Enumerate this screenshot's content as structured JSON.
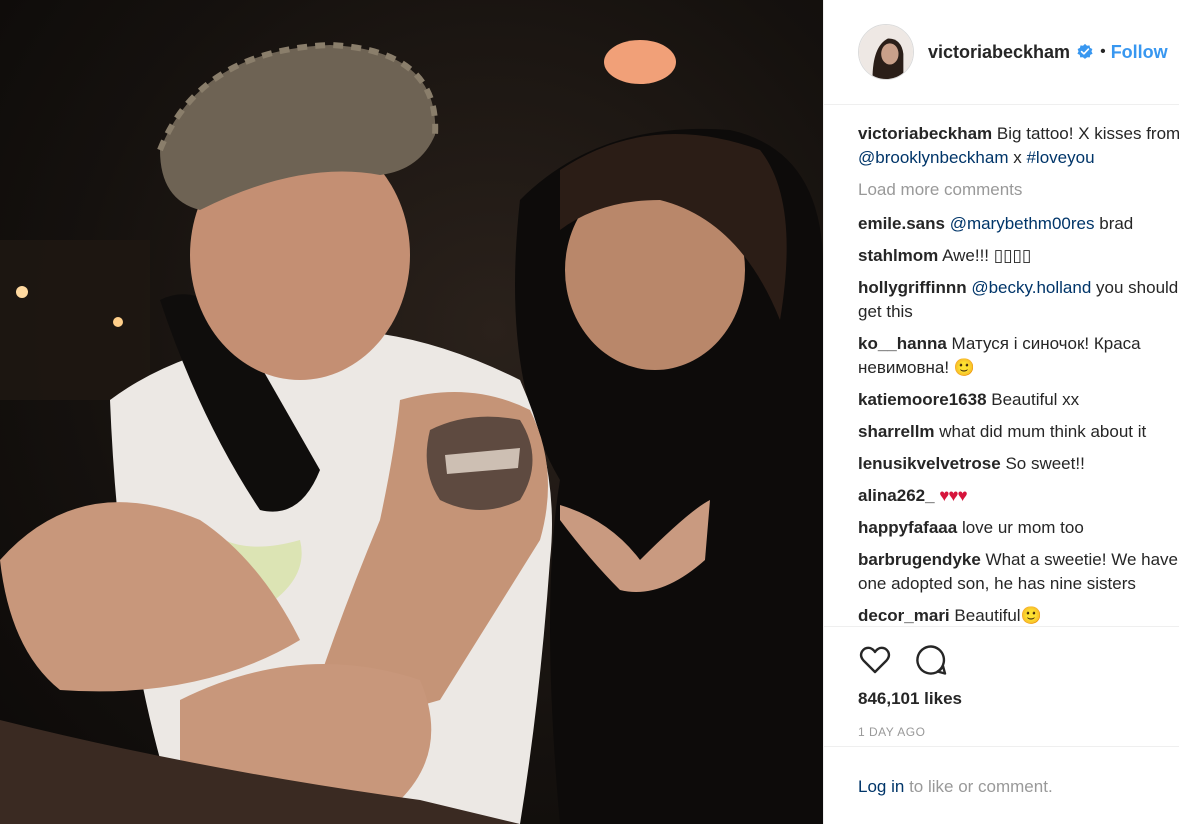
{
  "post": {
    "username": "victoriabeckham",
    "separator": "•",
    "follow_label": "Follow",
    "caption": {
      "user": "victoriabeckham",
      "text": "Big tattoo! X kisses from NYC!!",
      "mention": "@brooklynbeckham",
      "mid": "x",
      "hashtag": "#loveyou"
    },
    "load_more": "Load more comments",
    "comments": [
      {
        "user": "emile.sans",
        "link": "@marybethm00res",
        "text": "brad"
      },
      {
        "user": "stahlmom",
        "link": "",
        "text": "Awe!!! ▯▯▯▯"
      },
      {
        "user": "hollygriffinnn",
        "link": "@becky.holland",
        "text": "you should get this"
      },
      {
        "user": "ko__hanna",
        "link": "",
        "text": "Матуся і синочок! Краса невимовна! 🙂"
      },
      {
        "user": "katiemoore1638",
        "link": "",
        "text": "Beautiful xx"
      },
      {
        "user": "sharrellm",
        "link": "",
        "text": "what did mum think about it"
      },
      {
        "user": "lenusikvelvetrose",
        "link": "",
        "text": "So sweet!!"
      },
      {
        "user": "alina262_",
        "link": "",
        "text": "♥♥♥"
      },
      {
        "user": "happyfafaaa",
        "link": "",
        "text": "love ur mom too"
      },
      {
        "user": "barbrugendyke",
        "link": "",
        "text": "What a sweetie! We have one adopted son, he has nine sisters"
      },
      {
        "user": "decor_mari",
        "link": "",
        "text": "Beautiful🙂"
      }
    ],
    "likes": "846,101 likes",
    "time_ago": "1 DAY AGO",
    "login": {
      "link": "Log in",
      "rest": "to like or comment."
    },
    "icons": {
      "like": "heart-icon",
      "comment": "comment-bubble-icon",
      "verified": "verified-badge-icon"
    },
    "colors": {
      "link": "#003569",
      "follow": "#3897f0",
      "verified": "#3897f0",
      "muted": "#999999"
    }
  }
}
